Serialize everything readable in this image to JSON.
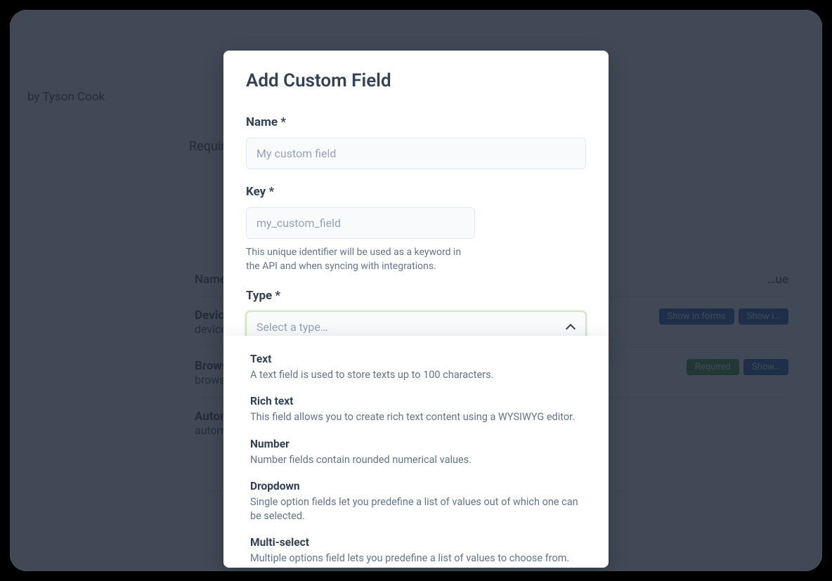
{
  "background": {
    "byline_prefix": "by ",
    "byline_author": "Tyson Cook",
    "tab_label": "Requirements",
    "columns": {
      "name": "Name",
      "value": "…ue"
    },
    "rows": [
      {
        "name": "Device",
        "key": "device",
        "badges": [
          {
            "text": "Show in forms",
            "cls": "badge-blue"
          },
          {
            "text": "Show i…",
            "cls": "badge-blue"
          }
        ]
      },
      {
        "name": "Browse…",
        "key": "browse…",
        "badges": [
          {
            "text": "Required",
            "cls": "badge-green"
          },
          {
            "text": "Show…",
            "cls": "badge-blue"
          }
        ]
      },
      {
        "name": "Autom…",
        "key": "automa…",
        "badges": []
      }
    ]
  },
  "modal": {
    "title": "Add Custom Field",
    "name_label": "Name *",
    "name_placeholder": "My custom field",
    "key_label": "Key *",
    "key_placeholder": "my_custom_field",
    "key_help": "This unique identifier will be used as a keyword in the API and when syncing with integrations.",
    "type_label": "Type *",
    "type_placeholder": "Select a type…"
  },
  "options": [
    {
      "title": "Text",
      "desc": "A text field is used to store texts up to 100 characters."
    },
    {
      "title": "Rich text",
      "desc": "This field allows you to create rich text content using a WYSIWYG editor."
    },
    {
      "title": "Number",
      "desc": "Number fields contain rounded numerical values."
    },
    {
      "title": "Dropdown",
      "desc": "Single option fields let you predefine a list of values out of which one can be selected."
    },
    {
      "title": "Multi-select",
      "desc": "Multiple options field lets you predefine a list of values to choose from."
    }
  ]
}
